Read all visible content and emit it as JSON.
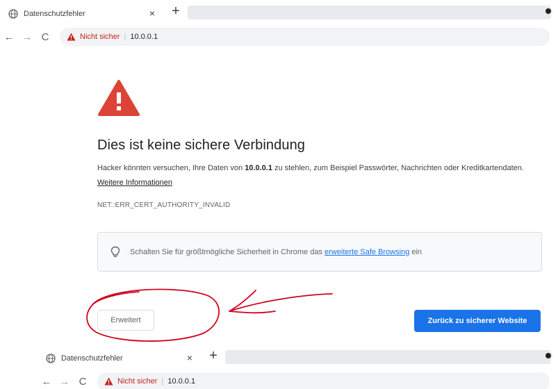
{
  "browser": {
    "tab_title": "Datenschutzfehler",
    "tab_close": "×",
    "new_tab": "+",
    "back": "←",
    "forward": "→",
    "reload": "C",
    "security_label": "Nicht sicher",
    "separator": "|",
    "url": "10.0.0.1"
  },
  "page": {
    "heading": "Dies ist keine sichere Verbindung",
    "paragraph_before": "Hacker könnten versuchen, Ihre Daten von ",
    "paragraph_host": "10.0.0.1",
    "paragraph_after": " zu stehlen, zum Beispiel Passwörter, Nachrichten oder Kreditkartendaten. ",
    "more_info_link": "Weitere Informationen",
    "error_code": "NET::ERR_CERT_AUTHORITY_INVALID",
    "safe_browsing_before": "Schalten Sie für größtmögliche Sicherheit in Chrome das ",
    "safe_browsing_link": "erweiterte Safe Browsing",
    "safe_browsing_after": " ein",
    "advanced_button": "Erweitert",
    "back_button": "Zurück zu sicherer Website"
  },
  "colors": {
    "warning_red": "#db4437",
    "primary_blue": "#1a73e8",
    "annotation_red": "#d0021b"
  },
  "icons": {
    "tab": "globe-icon",
    "omnibox": "warning-triangle-icon",
    "hero": "warning-triangle-icon",
    "safe_browsing": "lightbulb-icon"
  }
}
